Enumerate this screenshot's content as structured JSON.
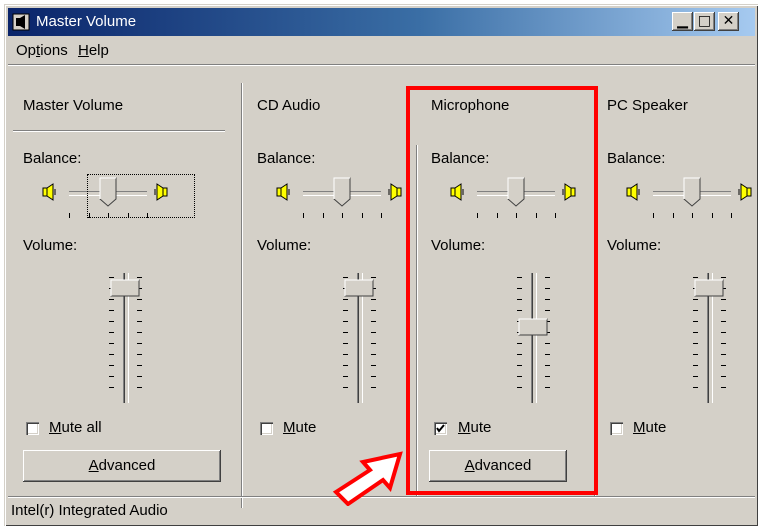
{
  "window": {
    "title": "Master Volume",
    "minimize_glyph": "▁",
    "maximize_glyph": "□",
    "close_glyph": "✕"
  },
  "menu": {
    "options_pre": "Op",
    "options_ul": "t",
    "options_post": "ions",
    "help_ul": "H",
    "help_post": "elp"
  },
  "columns": [
    {
      "title": "Master Volume",
      "balance_label": "Balance:",
      "volume_label": "Volume:",
      "mute_ul": "M",
      "mute_post": "ute all",
      "mute_checked": false,
      "advanced_ul": "A",
      "advanced_post": "dvanced",
      "volume_level": 0.95,
      "balance_level": 0.5
    },
    {
      "title": "CD Audio",
      "balance_label": "Balance:",
      "volume_label": "Volume:",
      "mute_ul": "M",
      "mute_post": "ute",
      "mute_checked": false,
      "volume_level": 0.95,
      "balance_level": 0.5
    },
    {
      "title": "Microphone",
      "balance_label": "Balance:",
      "volume_label": "Volume:",
      "mute_ul": "M",
      "mute_post": "ute",
      "mute_checked": true,
      "advanced_ul": "A",
      "advanced_post": "dvanced",
      "volume_level": 0.6,
      "balance_level": 0.5
    },
    {
      "title": "PC Speaker",
      "balance_label": "Balance:",
      "volume_label": "Volume:",
      "mute_ul": "M",
      "mute_post": "ute",
      "mute_checked": false,
      "volume_level": 0.95,
      "balance_level": 0.5
    }
  ],
  "status": {
    "text": "Intel(r) Integrated Audio"
  },
  "colors": {
    "highlight": "#ff0000",
    "titlebar": "#0a246a",
    "face": "#d4d0c8"
  }
}
